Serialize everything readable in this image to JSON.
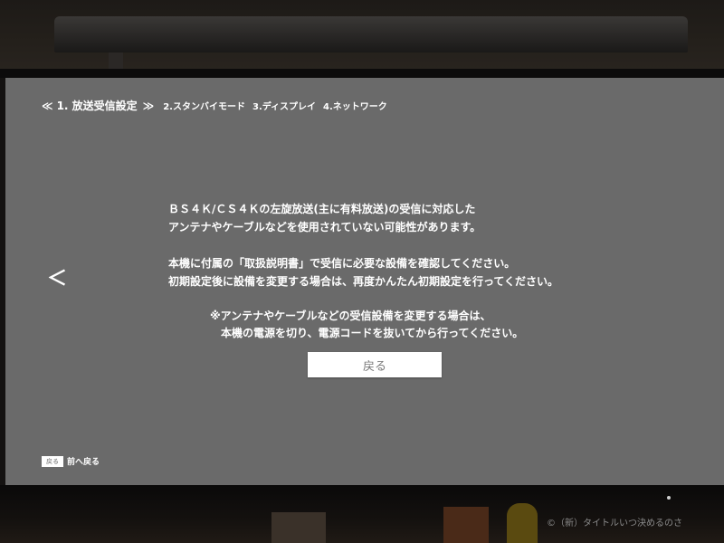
{
  "wizard": {
    "prev_arrow": "≪",
    "next_arrow": "≫",
    "current_step": "1. 放送受信設定",
    "step2": "2.スタンバイモード",
    "step3": "3.ディスプレイ",
    "step4": "4.ネットワーク"
  },
  "nav": {
    "left_arrow": "＜"
  },
  "message": {
    "line1": "ＢＳ４Ｋ/ＣＳ４Ｋの左旋放送(主に有料放送)の受信に対応した",
    "line2": "アンテナやケーブルなどを使用されていない可能性があります。",
    "line3": "本機に付属の「取扱説明書」で受信に必要な設備を確認してください。",
    "line4": "初期設定後に設備を変更する場合は、再度かんたん初期設定を行ってください。",
    "note1": "※アンテナやケーブルなどの受信設備を変更する場合は、",
    "note2": "本機の電源を切り、電源コードを抜いてから行ってください。"
  },
  "buttons": {
    "back_label": "戻る"
  },
  "footer": {
    "remote_key": "戻る",
    "hint": "前へ戻る"
  },
  "watermark": "©（新）タイトルいつ決めるのさ",
  "colors": {
    "screen_bg": "#6a6a6a",
    "text": "#ffffff",
    "button_bg": "#ffffff",
    "button_text": "#7a7a7a"
  }
}
